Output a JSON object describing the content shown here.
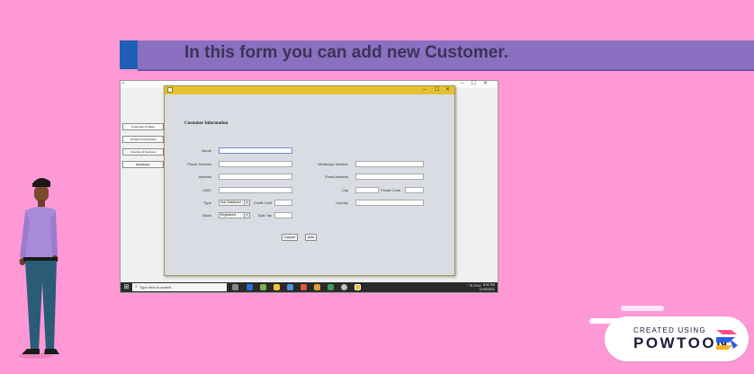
{
  "banner": {
    "text": "In this form you can add new Customer."
  },
  "side_menu": [
    {
      "label": "Customers & Sales"
    },
    {
      "label": "Vendors & Purchases"
    },
    {
      "label": "Inventory & Services"
    },
    {
      "label": "Distributor"
    }
  ],
  "dialog": {
    "heading": "Customer Information",
    "controls": {
      "minimize": "–",
      "maximize": "☐",
      "close": "✕"
    },
    "fields": {
      "name": {
        "label": "Name",
        "value": ""
      },
      "phone": {
        "label": "Phone Number",
        "value": ""
      },
      "address": {
        "label": "Address",
        "value": ""
      },
      "cnic": {
        "label": "CNIC",
        "value": ""
      },
      "type": {
        "label": "Type",
        "selected": "Sub Distributor"
      },
      "credit_limit": {
        "label": "Credit Limit",
        "value": ""
      },
      "block": {
        "label": "Block",
        "selected": "Registered"
      },
      "sale_tax": {
        "label": "Sale Tax",
        "value": ""
      },
      "whatsapp": {
        "label": "WhatsApp Number",
        "value": ""
      },
      "email": {
        "label": "Email Address",
        "value": ""
      },
      "city": {
        "label": "City",
        "value": ""
      },
      "postal_code": {
        "label": "Postal Code",
        "value": ""
      },
      "country": {
        "label": "Country",
        "value": ""
      }
    },
    "buttons": {
      "cancel": "Cancel",
      "add": "Add"
    }
  },
  "taskbar": {
    "search_placeholder": "Type here to search",
    "tray_text": "^ ⇅ ENG",
    "clock_time": "8:52 PM",
    "clock_date": "11/09/2021"
  },
  "watermark": {
    "small": "CREATED USING",
    "big": "POWTOON"
  },
  "colors": {
    "background": "#ff99d6",
    "banner": "#8b6fc1",
    "dialog_titlebar": "#e4c12f",
    "taskbar": "#2a2a2a"
  }
}
